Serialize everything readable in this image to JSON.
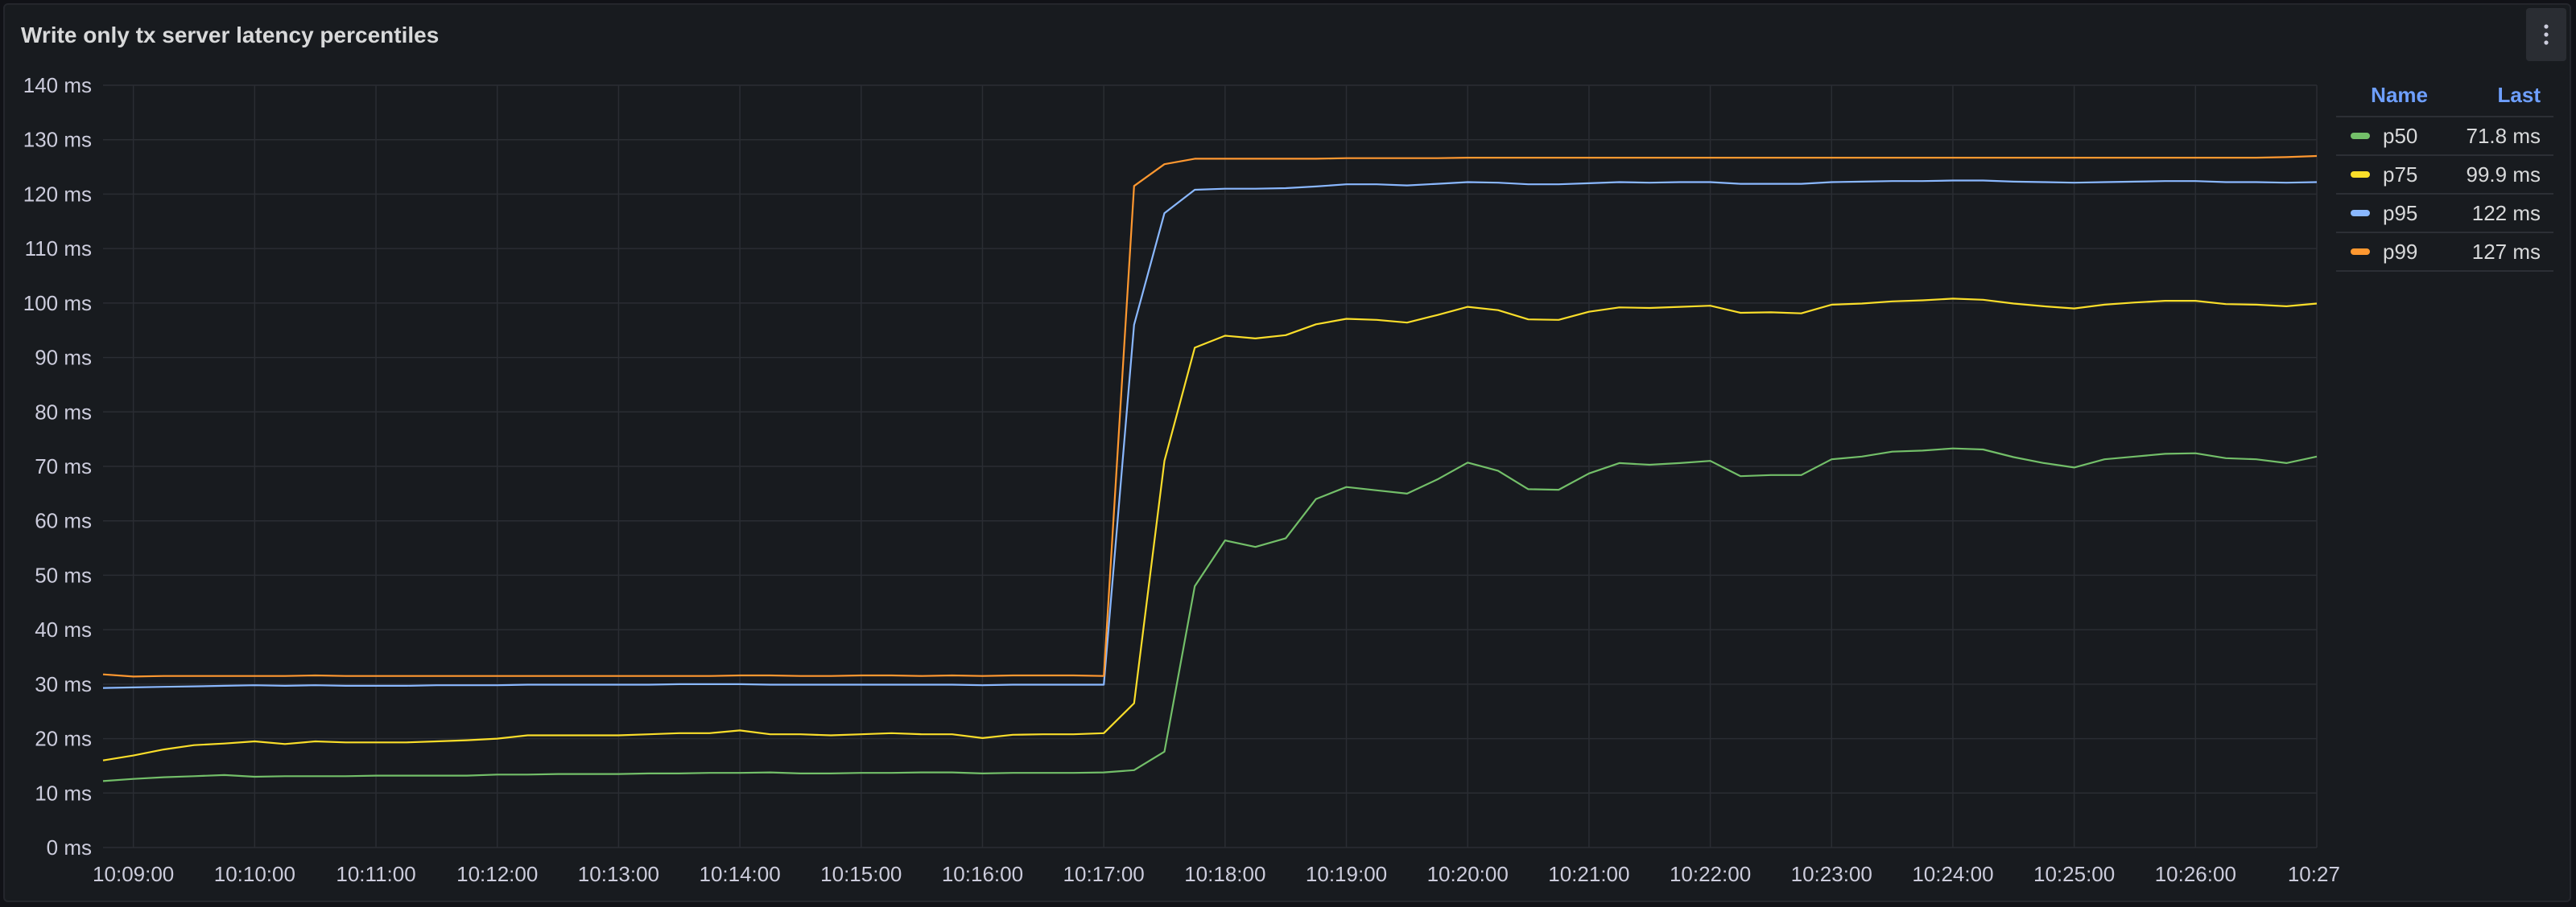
{
  "panel": {
    "title": "Write only tx server latency percentiles",
    "menu_icon": "kebab-menu-icon"
  },
  "legend": {
    "header_name": "Name",
    "header_last": "Last",
    "items": [
      {
        "name": "p50",
        "last": "71.8 ms",
        "color": "#73bf69"
      },
      {
        "name": "p75",
        "last": "99.9 ms",
        "color": "#fade2a"
      },
      {
        "name": "p95",
        "last": "122 ms",
        "color": "#8ab8ff"
      },
      {
        "name": "p99",
        "last": "127 ms",
        "color": "#ff9830"
      }
    ]
  },
  "chart_data": {
    "type": "line",
    "title": "Write only tx server latency percentiles",
    "unit": "ms",
    "ylim": [
      0,
      140
    ],
    "y_ticks": [
      0,
      10,
      20,
      30,
      40,
      50,
      60,
      70,
      80,
      90,
      100,
      110,
      120,
      130,
      140
    ],
    "y_tick_labels": [
      "0 ms",
      "10 ms",
      "20 ms",
      "30 ms",
      "40 ms",
      "50 ms",
      "60 ms",
      "70 ms",
      "80 ms",
      "90 ms",
      "100 ms",
      "110 ms",
      "120 ms",
      "130 ms",
      "140 ms"
    ],
    "x_tick_labels": [
      "10:09:00",
      "10:10:00",
      "10:11:00",
      "10:12:00",
      "10:13:00",
      "10:14:00",
      "10:15:00",
      "10:16:00",
      "10:17:00",
      "10:18:00",
      "10:19:00",
      "10:20:00",
      "10:21:00",
      "10:22:00",
      "10:23:00",
      "10:24:00",
      "10:25:00",
      "10:26:00",
      "10:27:"
    ],
    "x": [
      "10:08:45",
      "10:09:00",
      "10:09:15",
      "10:09:30",
      "10:09:45",
      "10:10:00",
      "10:10:15",
      "10:10:30",
      "10:10:45",
      "10:11:00",
      "10:11:15",
      "10:11:30",
      "10:11:45",
      "10:12:00",
      "10:12:15",
      "10:12:30",
      "10:12:45",
      "10:13:00",
      "10:13:15",
      "10:13:30",
      "10:13:45",
      "10:14:00",
      "10:14:15",
      "10:14:30",
      "10:14:45",
      "10:15:00",
      "10:15:15",
      "10:15:30",
      "10:15:45",
      "10:16:00",
      "10:16:15",
      "10:16:30",
      "10:16:45",
      "10:17:00",
      "10:17:15",
      "10:17:30",
      "10:17:45",
      "10:18:00",
      "10:18:15",
      "10:18:30",
      "10:18:45",
      "10:19:00",
      "10:19:15",
      "10:19:30",
      "10:19:45",
      "10:20:00",
      "10:20:15",
      "10:20:30",
      "10:20:45",
      "10:21:00",
      "10:21:15",
      "10:21:30",
      "10:21:45",
      "10:22:00",
      "10:22:15",
      "10:22:30",
      "10:22:45",
      "10:23:00",
      "10:23:15",
      "10:23:30",
      "10:23:45",
      "10:24:00",
      "10:24:15",
      "10:24:30",
      "10:24:45",
      "10:25:00",
      "10:25:15",
      "10:25:30",
      "10:25:45",
      "10:26:00",
      "10:26:15",
      "10:26:30",
      "10:26:45",
      "10:27:00"
    ],
    "series": [
      {
        "name": "p50",
        "color": "#73bf69",
        "values": [
          12.2,
          12.6,
          12.9,
          13.1,
          13.3,
          13.0,
          13.1,
          13.1,
          13.1,
          13.2,
          13.2,
          13.2,
          13.2,
          13.4,
          13.4,
          13.5,
          13.5,
          13.5,
          13.6,
          13.6,
          13.7,
          13.7,
          13.8,
          13.6,
          13.6,
          13.7,
          13.7,
          13.8,
          13.8,
          13.6,
          13.7,
          13.7,
          13.7,
          13.8,
          14.2,
          17.6,
          48.0,
          56.4,
          55.2,
          56.8,
          64.0,
          66.2,
          65.6,
          65.0,
          67.6,
          70.7,
          69.2,
          65.8,
          65.7,
          68.7,
          70.6,
          70.3,
          70.6,
          71.0,
          68.2,
          68.4,
          68.4,
          71.3,
          71.8,
          72.7,
          72.9,
          73.3,
          73.1,
          71.7,
          70.6,
          69.8,
          71.3,
          71.8,
          72.3,
          72.4,
          71.5,
          71.3,
          70.6,
          71.8
        ]
      },
      {
        "name": "p75",
        "color": "#fade2a",
        "values": [
          16.0,
          16.9,
          18.0,
          18.8,
          19.1,
          19.5,
          19.0,
          19.5,
          19.3,
          19.3,
          19.3,
          19.5,
          19.7,
          20.0,
          20.6,
          20.6,
          20.6,
          20.6,
          20.8,
          21.0,
          21.0,
          21.5,
          20.8,
          20.8,
          20.6,
          20.8,
          21.0,
          20.8,
          20.8,
          20.1,
          20.7,
          20.8,
          20.8,
          21.0,
          26.5,
          71.0,
          91.8,
          94.0,
          93.5,
          94.1,
          96.1,
          97.1,
          96.9,
          96.4,
          97.8,
          99.3,
          98.7,
          97.0,
          96.9,
          98.4,
          99.2,
          99.1,
          99.3,
          99.5,
          98.2,
          98.3,
          98.1,
          99.7,
          99.9,
          100.3,
          100.5,
          100.8,
          100.6,
          99.9,
          99.4,
          99.0,
          99.7,
          100.1,
          100.4,
          100.4,
          99.8,
          99.7,
          99.4,
          99.9
        ]
      },
      {
        "name": "p95",
        "color": "#8ab8ff",
        "values": [
          29.3,
          29.4,
          29.5,
          29.6,
          29.7,
          29.8,
          29.7,
          29.8,
          29.7,
          29.7,
          29.7,
          29.8,
          29.8,
          29.8,
          29.9,
          29.9,
          29.9,
          29.9,
          29.9,
          30.0,
          30.0,
          30.0,
          29.9,
          29.9,
          29.9,
          29.9,
          29.9,
          29.9,
          29.9,
          29.8,
          29.9,
          29.9,
          29.9,
          29.9,
          96.0,
          116.5,
          120.8,
          121.0,
          121.0,
          121.1,
          121.4,
          121.8,
          121.8,
          121.6,
          121.9,
          122.2,
          122.1,
          121.8,
          121.8,
          122.0,
          122.2,
          122.1,
          122.2,
          122.2,
          121.9,
          121.9,
          121.9,
          122.2,
          122.3,
          122.4,
          122.4,
          122.5,
          122.5,
          122.3,
          122.2,
          122.1,
          122.2,
          122.3,
          122.4,
          122.4,
          122.2,
          122.2,
          122.1,
          122.2
        ]
      },
      {
        "name": "p99",
        "color": "#ff9830",
        "values": [
          31.8,
          31.4,
          31.5,
          31.5,
          31.5,
          31.5,
          31.5,
          31.6,
          31.5,
          31.5,
          31.5,
          31.5,
          31.5,
          31.5,
          31.5,
          31.5,
          31.5,
          31.5,
          31.5,
          31.5,
          31.5,
          31.6,
          31.6,
          31.5,
          31.5,
          31.6,
          31.6,
          31.5,
          31.6,
          31.5,
          31.6,
          31.6,
          31.6,
          31.5,
          121.5,
          125.5,
          126.5,
          126.5,
          126.5,
          126.5,
          126.5,
          126.6,
          126.6,
          126.6,
          126.6,
          126.7,
          126.7,
          126.7,
          126.7,
          126.7,
          126.7,
          126.7,
          126.7,
          126.7,
          126.7,
          126.7,
          126.7,
          126.7,
          126.7,
          126.7,
          126.7,
          126.7,
          126.7,
          126.7,
          126.7,
          126.7,
          126.7,
          126.7,
          126.7,
          126.7,
          126.7,
          126.7,
          126.8,
          127.0
        ]
      }
    ],
    "grid": true,
    "legend_position": "right"
  }
}
